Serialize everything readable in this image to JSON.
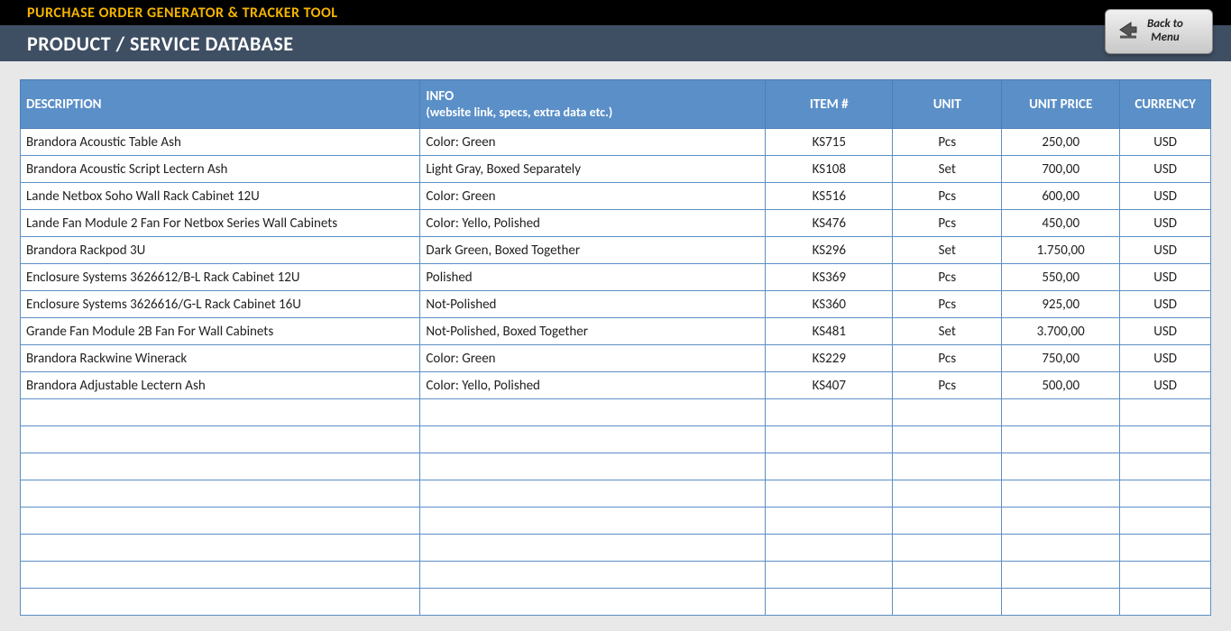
{
  "header": {
    "app_title": "PURCHASE ORDER GENERATOR & TRACKER TOOL",
    "page_title": "PRODUCT / SERVICE DATABASE",
    "back_line1": "Back to",
    "back_line2": "Menu"
  },
  "table": {
    "columns": {
      "description": "DESCRIPTION",
      "info_main": "INFO",
      "info_sub": "(website link, specs, extra data etc.)",
      "item": "ITEM #",
      "unit": "UNIT",
      "unit_price": "UNIT PRICE",
      "currency": "CURRENCY"
    },
    "rows": [
      {
        "description": "Brandora Acoustic Table Ash",
        "info": "Color: Green",
        "item": "KS715",
        "unit": "Pcs",
        "unit_price": "250,00",
        "currency": "USD"
      },
      {
        "description": "Brandora Acoustic Script Lectern Ash",
        "info": "Light Gray, Boxed Separately",
        "item": "KS108",
        "unit": "Set",
        "unit_price": "700,00",
        "currency": "USD"
      },
      {
        "description": "Lande Netbox Soho Wall Rack Cabinet 12U",
        "info": "Color: Green",
        "item": "KS516",
        "unit": "Pcs",
        "unit_price": "600,00",
        "currency": "USD"
      },
      {
        "description": "Lande Fan Module 2 Fan For Netbox Series Wall Cabinets",
        "info": "Color: Yello, Polished",
        "item": "KS476",
        "unit": "Pcs",
        "unit_price": "450,00",
        "currency": "USD"
      },
      {
        "description": "Brandora Rackpod 3U",
        "info": "Dark Green, Boxed Together",
        "item": "KS296",
        "unit": "Set",
        "unit_price": "1.750,00",
        "currency": "USD"
      },
      {
        "description": "Enclosure Systems 3626612/B-L Rack Cabinet 12U",
        "info": "Polished",
        "item": "KS369",
        "unit": "Pcs",
        "unit_price": "550,00",
        "currency": "USD"
      },
      {
        "description": "Enclosure Systems 3626616/G-L Rack Cabinet 16U",
        "info": "Not-Polished",
        "item": "KS360",
        "unit": "Pcs",
        "unit_price": "925,00",
        "currency": "USD"
      },
      {
        "description": "Grande Fan Module 2B Fan For Wall Cabinets",
        "info": "Not-Polished, Boxed Together",
        "item": "KS481",
        "unit": "Set",
        "unit_price": "3.700,00",
        "currency": "USD"
      },
      {
        "description": "Brandora Rackwine Winerack",
        "info": "Color: Green",
        "item": "KS229",
        "unit": "Pcs",
        "unit_price": "750,00",
        "currency": "USD"
      },
      {
        "description": "Brandora Adjustable Lectern Ash",
        "info": "Color: Yello, Polished",
        "item": "KS407",
        "unit": "Pcs",
        "unit_price": "500,00",
        "currency": "USD"
      }
    ],
    "empty_row_count": 8
  }
}
